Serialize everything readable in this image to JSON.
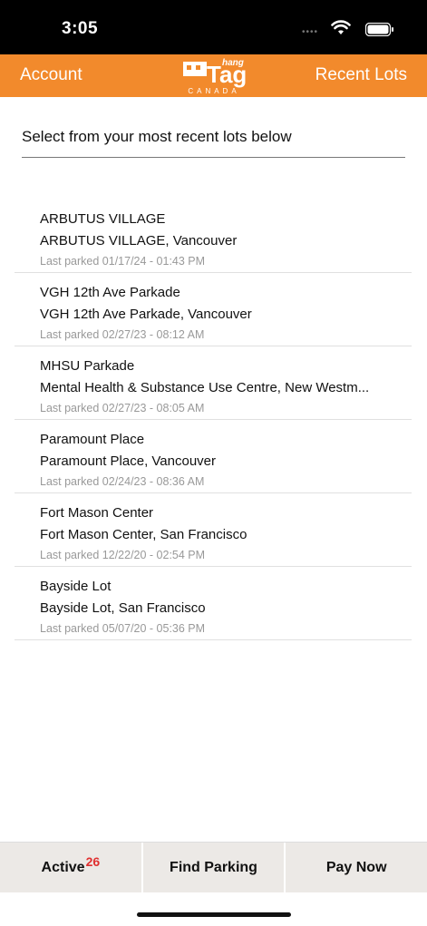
{
  "status": {
    "time": "3:05"
  },
  "nav": {
    "left_label": "Account",
    "right_label": "Recent Lots",
    "logo": {
      "hang": "hang",
      "tag": "Tag",
      "canada": "CANADA"
    }
  },
  "header": {
    "prompt": "Select from your most recent lots below"
  },
  "lots": [
    {
      "name": "ARBUTUS VILLAGE",
      "address": "ARBUTUS VILLAGE, Vancouver",
      "last_parked": "Last parked 01/17/24 - 01:43 PM"
    },
    {
      "name": "VGH 12th Ave Parkade",
      "address": "VGH 12th Ave Parkade, Vancouver",
      "last_parked": "Last parked 02/27/23 - 08:12 AM"
    },
    {
      "name": "MHSU Parkade",
      "address": "Mental Health & Substance Use Centre, New Westm...",
      "last_parked": "Last parked 02/27/23 - 08:05 AM"
    },
    {
      "name": "Paramount Place",
      "address": "Paramount Place, Vancouver",
      "last_parked": "Last parked 02/24/23 - 08:36 AM"
    },
    {
      "name": "Fort Mason Center",
      "address": "Fort Mason Center, San Francisco",
      "last_parked": "Last parked 12/22/20 - 02:54 PM"
    },
    {
      "name": "Bayside Lot",
      "address": "Bayside Lot, San Francisco",
      "last_parked": "Last parked 05/07/20 - 05:36 PM"
    }
  ],
  "tabs": {
    "active_label": "Active",
    "active_badge": "26",
    "find_parking_label": "Find Parking",
    "pay_now_label": "Pay Now"
  },
  "colors": {
    "brand_orange": "#f28a2c",
    "badge_red": "#e03030",
    "tab_bg": "#ece9e6"
  }
}
